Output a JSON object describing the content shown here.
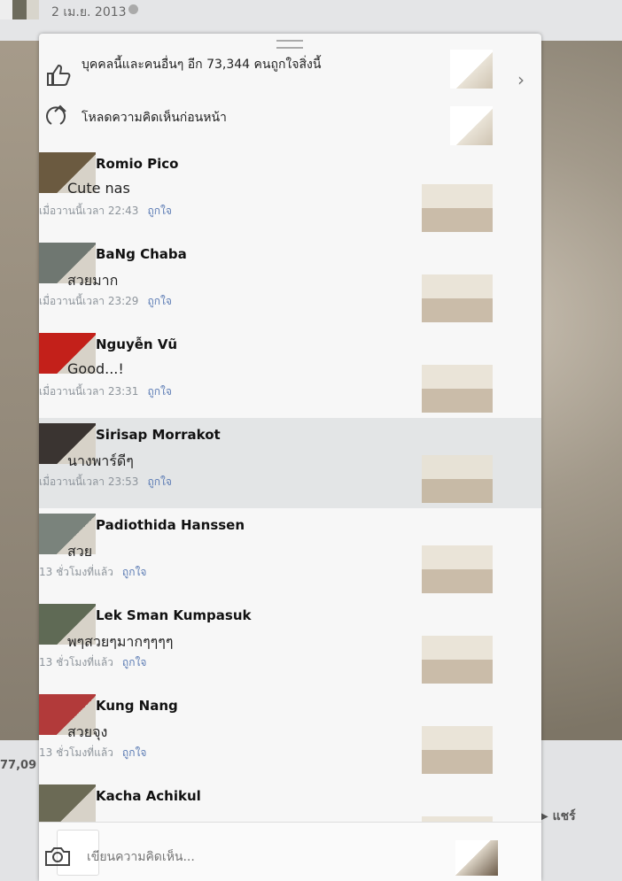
{
  "topbar": {
    "date": "2 เม.ย. 2013"
  },
  "bottombar": {
    "count_partial": "77,09",
    "share_label": "แชร์"
  },
  "panel": {
    "likes_summary": "บุคคลนี้และคนอื่นๆ อีก 73,344 คนถูกใจสิ่งนี้",
    "load_previous": "โหลดความคิดเห็นก่อนหน้า",
    "composer_placeholder": "เขียนความคิดเห็น..."
  },
  "comments": [
    {
      "name": "Romio Pico",
      "text": "Cute nas",
      "time": "เมื่อวานนี้เวลา 22:43",
      "like": "ถูกใจ",
      "avatar_color": "#6b5a40"
    },
    {
      "name": "BaNg Chaba",
      "text": "สวยมาก",
      "time": "เมื่อวานนี้เวลา 23:29",
      "like": "ถูกใจ",
      "avatar_color": "#6f7771"
    },
    {
      "name": "Nguyễn Vũ",
      "text": "Good...!",
      "time": "เมื่อวานนี้เวลา 23:31",
      "like": "ถูกใจ",
      "avatar_color": "#c3201a"
    },
    {
      "name": "Sirisap Morrakot",
      "text": "นางพาร์ดีๆ",
      "time": "เมื่อวานนี้เวลา 23:53",
      "like": "ถูกใจ",
      "avatar_color": "#3a3431"
    },
    {
      "name": "Padiothida Hanssen",
      "text": "สวย",
      "time": "13 ชั่วโมงที่แล้ว",
      "like": "ถูกใจ",
      "avatar_color": "#7a837c"
    },
    {
      "name": "Lek Sman Kumpasuk",
      "text": "พๆสวยๆมากๆๆๆๆ",
      "time": "13 ชั่วโมงที่แล้ว",
      "like": "ถูกใจ",
      "avatar_color": "#5f6a55"
    },
    {
      "name": "Kung Nang",
      "text": "สวยจุง",
      "time": "13 ชั่วโมงที่แล้ว",
      "like": "ถูกใจ",
      "avatar_color": "#b23a3a"
    },
    {
      "name": "Kacha Achikul",
      "text": "",
      "time": "",
      "like": "",
      "avatar_color": "#6b6a55"
    }
  ]
}
